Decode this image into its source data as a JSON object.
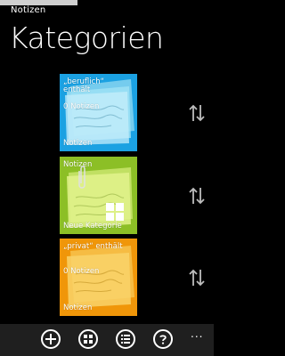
{
  "app": {
    "title": "Notizen"
  },
  "page": {
    "title": "Kategorien"
  },
  "tiles": [
    {
      "line1": "„beruflich“",
      "line2": "enthält",
      "line3": "0 Notizen",
      "footer": "Notizen",
      "color": "#1ba1e2"
    },
    {
      "line1": "Notizen",
      "footer": "Neue Kategorie",
      "color": "#8cbf26"
    },
    {
      "line1": "„privat“ enthält",
      "line3": "0 Notizen",
      "footer": "Notizen",
      "color": "#f09609"
    }
  ],
  "appbar": {
    "buttons": [
      {
        "icon": "add-icon"
      },
      {
        "icon": "tiles-icon"
      },
      {
        "icon": "list-icon"
      },
      {
        "icon": "help-icon"
      }
    ],
    "more": "..."
  }
}
